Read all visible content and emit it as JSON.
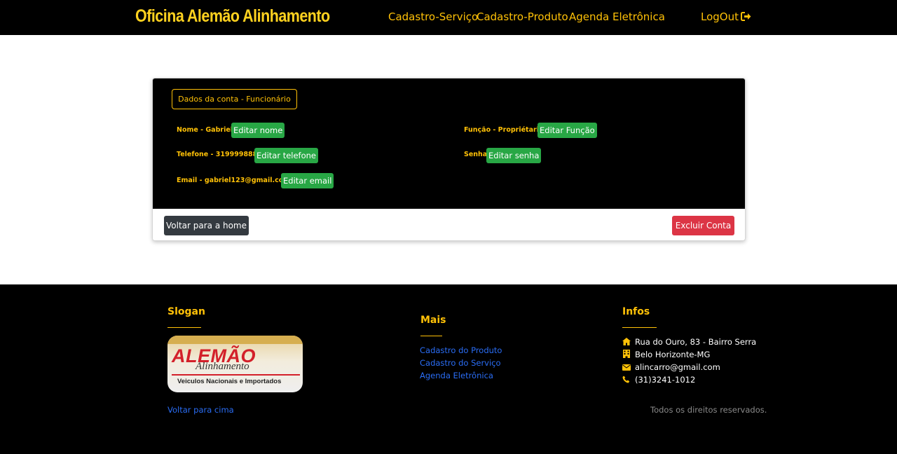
{
  "header": {
    "brand": "Oficina Alemão Alinhamento",
    "nav": [
      "Cadastro-Serviço",
      "Cadastro-Produto",
      "Agenda Eletrônica"
    ],
    "logout": "LogOut",
    "logout_icon": "sign-out-icon"
  },
  "account": {
    "legend": "Dados da conta - Funcionário",
    "name_label": "Nome - Gabriel",
    "edit_name": "Editar nome",
    "phone_label": "Telefone - 3199998888",
    "edit_phone": "Editar telefone",
    "email_label": "Email - gabriel123@gmail.com",
    "edit_email": "Editar email",
    "role_label": "Função - Propriétario",
    "edit_role": "Editar Função",
    "password_label": "Senha",
    "edit_password": "Editar senha",
    "back_home": "Voltar para a home",
    "delete_account": "Excluir Conta"
  },
  "footer": {
    "slogan_heading": "Slogan",
    "logo": {
      "main": "ALEMÃO",
      "sub": "Alinhamento",
      "tagline": "Veiculos Nacionais e Importados"
    },
    "back_to_top": "Voltar para cima",
    "more_heading": "Mais",
    "more_links": [
      "Cadastro do Produto",
      "Cadastro do Serviço",
      "Agenda Eletrônica"
    ],
    "infos_heading": "Infos",
    "infos": [
      {
        "icon": "home-icon",
        "text": "Rua do Ouro, 83 - Bairro Serra"
      },
      {
        "icon": "building-icon",
        "text": "Belo Horizonte-MG"
      },
      {
        "icon": "envelope-icon",
        "text": "alincarro@gmail.com"
      },
      {
        "icon": "phone-icon",
        "text": "(31)3241-1012"
      }
    ],
    "rights": "Todos os direitos reservados."
  },
  "colors": {
    "accent": "#ffc107",
    "brand": "#ffd21f",
    "success": "#28a745",
    "danger": "#dc3545",
    "dark": "#343a40",
    "link": "#2a6df5"
  }
}
